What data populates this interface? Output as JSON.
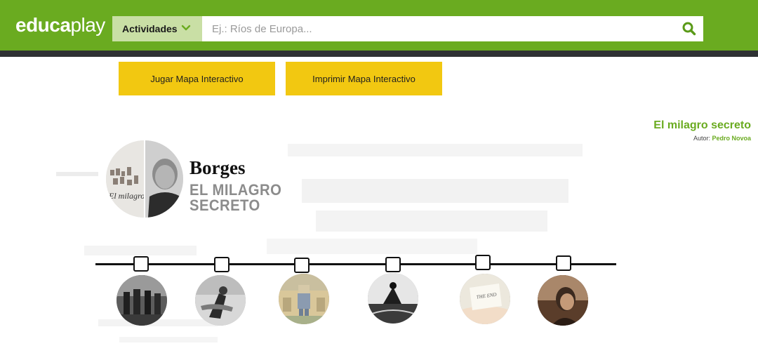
{
  "header": {
    "logo_bold": "educa",
    "logo_light": "play",
    "category_label": "Actividades",
    "search_placeholder": "Ej.: Ríos de Europa...",
    "icons": {
      "chevron": "chevron-down-icon",
      "search": "search-icon"
    }
  },
  "actions": {
    "play_label": "Jugar Mapa Interactivo",
    "print_label": "Imprimir Mapa Interactivo"
  },
  "activity": {
    "title": "El milagro secreto",
    "author_prefix": "Autor:",
    "author_name": "Pedro Novoa"
  },
  "cover": {
    "heading": "Borges",
    "subtitle_line1": "EL MILAGRO",
    "subtitle_line2": "SECRETO"
  },
  "timeline": {
    "markers": 6
  },
  "colors": {
    "brand_green": "#6aab20",
    "dark_strip": "#2e3133",
    "button_yellow": "#f2c811",
    "category_bg": "#c9dfa5"
  }
}
